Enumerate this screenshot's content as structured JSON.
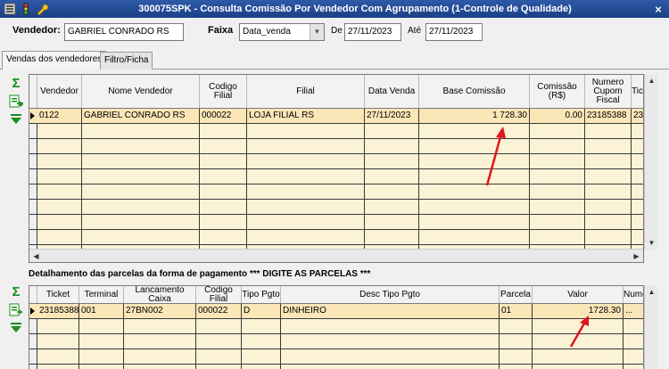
{
  "window": {
    "title": "300075SPK - Consulta Comissão Por Vendedor Com Agrupamento (1-Controle de Qualidade)",
    "close_glyph": "×"
  },
  "filters": {
    "vendedor_label": "Vendedor:",
    "vendedor_value": "GABRIEL CONRADO RS",
    "faixa_label": "Faixa",
    "faixa_value": "Data_venda",
    "de_label": "De",
    "de_value": "27/11/2023",
    "ate_label": "Até",
    "ate_value": "27/11/2023"
  },
  "tabs": [
    {
      "label": "Vendas dos vendedores",
      "active": true
    },
    {
      "label": "Filtro/Ficha",
      "active": false
    }
  ],
  "sales_grid": {
    "columns": [
      "Vendedor",
      "Nome Vendedor",
      "Codigo Filial",
      "Filial",
      "Data Venda",
      "Base Comissão",
      "Comissão (R$)",
      "Numero Cupom Fiscal",
      "Tick"
    ],
    "rows": [
      {
        "vendedor": "0122",
        "nome": "GABRIEL CONRADO RS",
        "codigo_filial": "000022",
        "filial": "LOJA FILIAL RS",
        "data_venda": "27/11/2023",
        "base_comissao": "1 728.30",
        "comissao": "0.00",
        "cupom": "23185388",
        "tick": "23"
      }
    ]
  },
  "payment_section": {
    "title": "Detalhamento das parcelas da forma de pagamento *** DIGITE AS PARCELAS ***"
  },
  "payment_grid": {
    "columns": [
      "Ticket",
      "Terminal",
      "Lancamento Caixa",
      "Codigo Filial",
      "Tipo Pgto",
      "Desc Tipo Pgto",
      "Parcela",
      "Valor",
      "Nume"
    ],
    "rows": [
      {
        "ticket": "23185388",
        "terminal": "001",
        "lancamento": "27BN002",
        "codigo_filial": "000022",
        "tipo": "D",
        "desc": "DINHEIRO",
        "parcela": "01",
        "valor": "1728.30",
        "nume": "..."
      }
    ]
  },
  "colors": {
    "title_bar": "#1b3f86",
    "grid_bg": "#fcf2d6",
    "selected_row": "#fbe6b8",
    "annotation_arrow": "#e0161b",
    "sigma": "#1a8f1a"
  }
}
